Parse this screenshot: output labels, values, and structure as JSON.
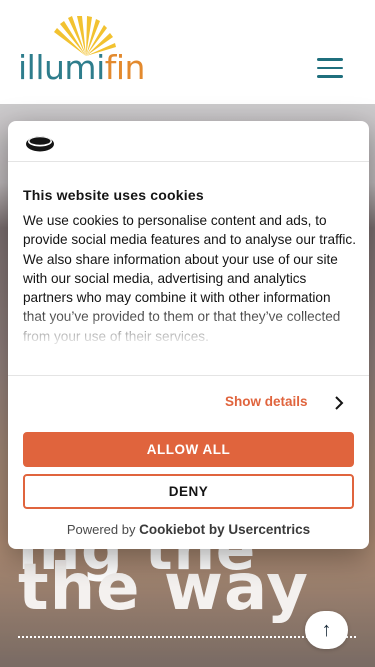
{
  "header": {
    "logo_text_main": "illumi",
    "logo_text_accent": "fin"
  },
  "hero": {
    "line1": "ing the",
    "line2": "the way"
  },
  "cookie_dialog": {
    "title": "This website uses cookies",
    "body": "We use cookies to personalise content and ads, to provide social media features and to analyse our traffic. We also share information about your use of our site with our social media, advertising and analytics partners who may combine it with other information that you’ve provided to them or that they’ve collected from your use of their services.",
    "show_details_label": "Show details",
    "allow_all_label": "ALLOW ALL",
    "deny_label": "DENY",
    "powered_prefix": "Powered by",
    "powered_brand": "Cookiebot by Usercentrics"
  },
  "icons": {
    "menu": "hamburger-menu-icon",
    "chevron": "chevron-right-icon",
    "scroll_top": "arrow-up-icon",
    "cookiebot": "cookiebot-logo-icon"
  },
  "colors": {
    "accent": "#e0643d",
    "brand_teal": "#2e7d8c",
    "brand_orange": "#e38a2e",
    "sun_yellow": "#f2c230"
  }
}
